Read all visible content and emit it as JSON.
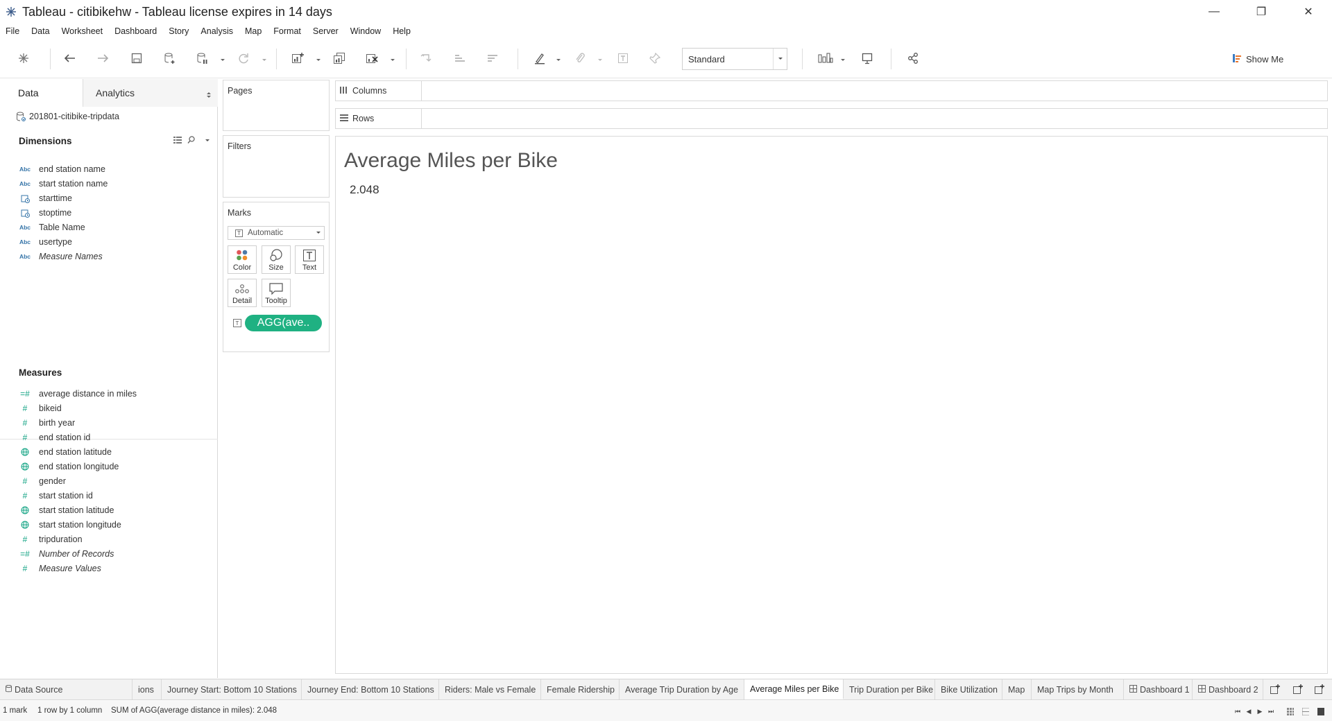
{
  "window": {
    "title": "Tableau - citibikehw - Tableau license expires in 14 days",
    "minimize": "—",
    "restore": "❐",
    "close": "✕"
  },
  "menu": [
    "File",
    "Data",
    "Worksheet",
    "Dashboard",
    "Story",
    "Analysis",
    "Map",
    "Format",
    "Server",
    "Window",
    "Help"
  ],
  "toolbar": {
    "fit_select": "Standard",
    "show_me": "Show Me"
  },
  "data_pane": {
    "tabs": {
      "data": "Data",
      "analytics": "Analytics"
    },
    "datasource": "201801-citibike-tripdata",
    "dimensions_title": "Dimensions",
    "dimensions": [
      {
        "label": "end station name",
        "icon": "Abc"
      },
      {
        "label": "start station name",
        "icon": "Abc"
      },
      {
        "label": "starttime",
        "icon": "calendar-icon"
      },
      {
        "label": "stoptime",
        "icon": "calendar-icon"
      },
      {
        "label": "Table Name",
        "icon": "Abc"
      },
      {
        "label": "usertype",
        "icon": "Abc"
      },
      {
        "label": "Measure Names",
        "icon": "Abc"
      }
    ],
    "measures_title": "Measures",
    "measures": [
      {
        "label": "average distance in miles",
        "icon": "calc-hash"
      },
      {
        "label": "bikeid",
        "icon": "#"
      },
      {
        "label": "birth year",
        "icon": "#"
      },
      {
        "label": "end station id",
        "icon": "#"
      },
      {
        "label": "end station latitude",
        "icon": "globe-icon"
      },
      {
        "label": "end station longitude",
        "icon": "globe-icon"
      },
      {
        "label": "gender",
        "icon": "#"
      },
      {
        "label": "start station id",
        "icon": "#"
      },
      {
        "label": "start station latitude",
        "icon": "globe-icon"
      },
      {
        "label": "start station longitude",
        "icon": "globe-icon"
      },
      {
        "label": "tripduration",
        "icon": "#"
      },
      {
        "label": "Number of Records",
        "icon": "calc-hash"
      },
      {
        "label": "Measure Values",
        "icon": "#"
      }
    ]
  },
  "cards": {
    "pages": "Pages",
    "filters": "Filters",
    "marks": "Marks",
    "mark_type": "Automatic",
    "mark_buttons": {
      "color": "Color",
      "size": "Size",
      "text": "Text",
      "detail": "Detail",
      "tooltip": "Tooltip"
    },
    "text_pill": "AGG(ave..",
    "mark_tag": "T"
  },
  "shelves": {
    "columns": "Columns",
    "rows": "Rows"
  },
  "viz": {
    "title": "Average Miles per Bike",
    "value": "2.048"
  },
  "sheet_tabs": [
    {
      "label": "Data Source",
      "active": false
    },
    {
      "label": "ions",
      "active": false
    },
    {
      "label": "Journey Start: Bottom 10 Stations",
      "active": false
    },
    {
      "label": "Journey End: Bottom 10 Stations",
      "active": false
    },
    {
      "label": "Riders: Male vs Female",
      "active": false
    },
    {
      "label": "Female Ridership",
      "active": false
    },
    {
      "label": "Average Trip Duration by Age",
      "active": false
    },
    {
      "label": "Average Miles per Bike",
      "active": true
    },
    {
      "label": "Trip Duration per Bike",
      "active": false
    },
    {
      "label": "Bike Utilization",
      "active": false
    },
    {
      "label": "Map",
      "active": false
    },
    {
      "label": "Map Trips by Month",
      "active": false
    },
    {
      "label": "Dashboard 1",
      "active": false
    },
    {
      "label": "Dashboard 2",
      "active": false
    }
  ],
  "status": {
    "marks": "1 mark",
    "dims": "1 row by 1 column",
    "sum": "SUM of AGG(average distance in miles): 2.048"
  },
  "colors": {
    "pill_green": "#1fb182",
    "field_blue": "#3574a8",
    "field_green": "#11a383"
  }
}
